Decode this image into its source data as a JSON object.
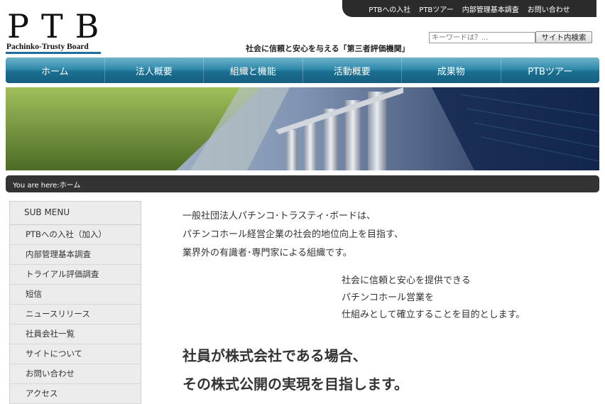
{
  "top_links": [
    "PTBへの入社",
    "PTBツアー",
    "内部管理基本調査",
    "お問い合わせ"
  ],
  "logo": {
    "main": "PTB",
    "sub": "Pachinko-Trusty Board"
  },
  "tagline": "社会に信頼と安心を与える「第三者評価機関」",
  "search": {
    "placeholder": "キーワードは？...",
    "button": "サイト内検索"
  },
  "nav": [
    "ホーム",
    "法人概要",
    "組織と機能",
    "活動概要",
    "成果物",
    "PTBツアー"
  ],
  "breadcrumb": "You are here:ホーム",
  "sidebar": {
    "title": "SUB MENU",
    "items": [
      "PTBへの入社（加入）",
      "内部管理基本調査",
      "トライアル評価調査",
      "短信",
      "ニュースリリース",
      "社員会社一覧",
      "サイトについて",
      "お問い合わせ",
      "アクセス"
    ]
  },
  "intro": [
    "一般社団法人パチンコ･トラスティ･ボードは、",
    "パチンコホール経営企業の社会的地位向上を目指す、",
    "業界外の有識者･専門家による組織です。"
  ],
  "mission": [
    "社会に信頼と安心を提供できる",
    "パチンコホール営業を",
    "仕組みとして確立することを目的とします。"
  ],
  "goal": [
    "社員が株式会社である場合、",
    "その株式公開の実現を目指します。"
  ],
  "colors": {
    "nav": "#2f8aab",
    "dark_bar": "#2b2b2b",
    "logo_accent": "#1f6f9a"
  }
}
